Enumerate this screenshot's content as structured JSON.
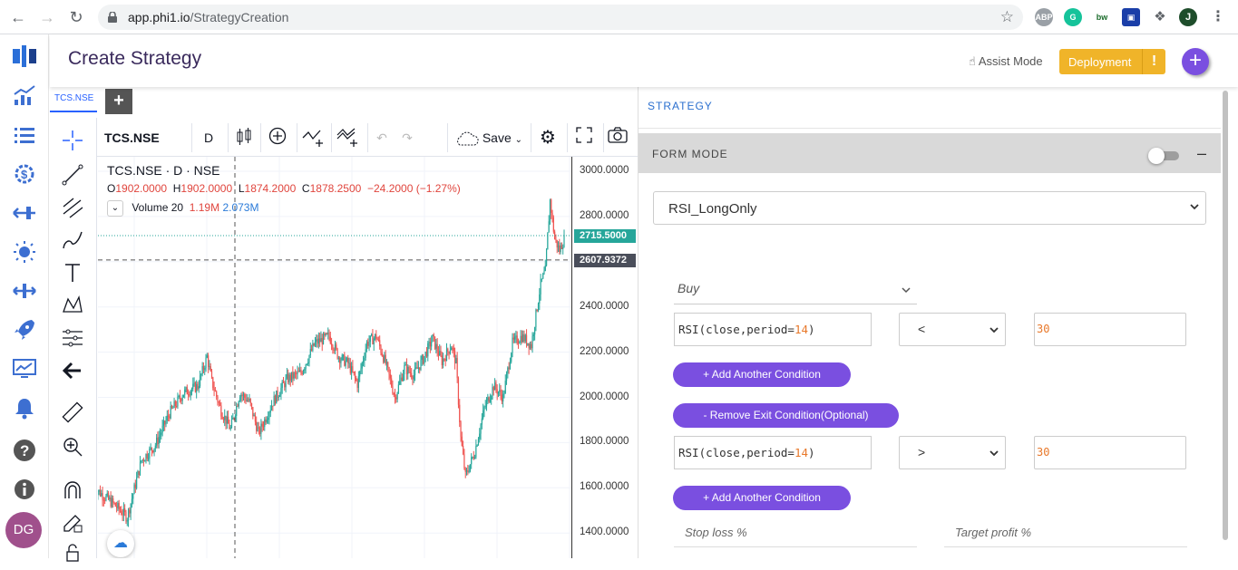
{
  "browser": {
    "url_host": "app.phi1.io",
    "url_path": "/StrategyCreation",
    "profile_initial": "J",
    "ext_abp": "ABP",
    "ext_bw": "bw"
  },
  "header": {
    "title": "Create Strategy",
    "assist_mode": "Assist Mode",
    "deployment": "Deployment",
    "deployment_alert": "!",
    "add": "+"
  },
  "sidebar": {
    "avatar_initials": "DG"
  },
  "chart_tabs": {
    "active": "TCS.NSE",
    "add": "+"
  },
  "toolbar": {
    "symbol": "TCS.NSE",
    "interval": "D",
    "save": "Save"
  },
  "legend": {
    "title": "TCS.NSE · D · NSE",
    "o_label": "O",
    "o": "1902.0000",
    "h_label": "H",
    "h": "1902.0000",
    "l_label": "L",
    "l": "1874.2000",
    "c_label": "C",
    "c": "1878.2500",
    "change": "−24.2000 (−1.27%)",
    "volume_label": "Volume 20",
    "volume_value": "1.19M",
    "volume_ma": "2.073M"
  },
  "chart_data": {
    "type": "candlestick",
    "symbol": "TCS.NSE",
    "interval": "D",
    "y_ticks": [
      "3000.0000",
      "2800.0000",
      "2600.0000",
      "2400.0000",
      "2200.0000",
      "2000.0000",
      "1800.0000",
      "1600.0000",
      "1400.0000"
    ],
    "ylim": [
      1300,
      3000
    ],
    "price_line": "2715.5000",
    "crosshair_price": "2607.9372",
    "close_path": [
      {
        "t": 0,
        "v": 1600
      },
      {
        "t": 4,
        "v": 1530
      },
      {
        "t": 7,
        "v": 1470
      },
      {
        "t": 10,
        "v": 1720
      },
      {
        "t": 13,
        "v": 1790
      },
      {
        "t": 16,
        "v": 1930
      },
      {
        "t": 19,
        "v": 2020
      },
      {
        "t": 22,
        "v": 2050
      },
      {
        "t": 24,
        "v": 2180
      },
      {
        "t": 25,
        "v": 2070
      },
      {
        "t": 27,
        "v": 1940
      },
      {
        "t": 29,
        "v": 1860
      },
      {
        "t": 31,
        "v": 2020
      },
      {
        "t": 33,
        "v": 1980
      },
      {
        "t": 35,
        "v": 1840
      },
      {
        "t": 38,
        "v": 1980
      },
      {
        "t": 41,
        "v": 2080
      },
      {
        "t": 44,
        "v": 2110
      },
      {
        "t": 47,
        "v": 2240
      },
      {
        "t": 50,
        "v": 2270
      },
      {
        "t": 52,
        "v": 2180
      },
      {
        "t": 54,
        "v": 2150
      },
      {
        "t": 56,
        "v": 2060
      },
      {
        "t": 58,
        "v": 2240
      },
      {
        "t": 60,
        "v": 2270
      },
      {
        "t": 62,
        "v": 2150
      },
      {
        "t": 64,
        "v": 2000
      },
      {
        "t": 66,
        "v": 2130
      },
      {
        "t": 68,
        "v": 2100
      },
      {
        "t": 70,
        "v": 2170
      },
      {
        "t": 72,
        "v": 2260
      },
      {
        "t": 74,
        "v": 2160
      },
      {
        "t": 76,
        "v": 2230
      },
      {
        "t": 77,
        "v": 2150
      },
      {
        "t": 78,
        "v": 1820
      },
      {
        "t": 79,
        "v": 1650
      },
      {
        "t": 81,
        "v": 1760
      },
      {
        "t": 83,
        "v": 1950
      },
      {
        "t": 85,
        "v": 2050
      },
      {
        "t": 87,
        "v": 2000
      },
      {
        "t": 89,
        "v": 2240
      },
      {
        "t": 91,
        "v": 2270
      },
      {
        "t": 93,
        "v": 2230
      },
      {
        "t": 95,
        "v": 2500
      },
      {
        "t": 96,
        "v": 2560
      },
      {
        "t": 97,
        "v": 2870
      },
      {
        "t": 98,
        "v": 2700
      },
      {
        "t": 99,
        "v": 2650
      },
      {
        "t": 100,
        "v": 2700
      }
    ]
  },
  "strategy": {
    "section_title": "STRATEGY",
    "form_mode": "FORM MODE",
    "collapse": "–",
    "selected_strategy": "RSI_LongOnly",
    "side_placeholder": "Buy",
    "entry": {
      "expr_prefix": "RSI(close,period=",
      "expr_num": "14",
      "expr_suffix": ")",
      "operator": "<",
      "value": "30"
    },
    "add_condition": "+ Add Another Condition",
    "remove_exit": "- Remove Exit Condition(Optional)",
    "exit": {
      "expr_prefix": "RSI(close,period=",
      "expr_num": "14",
      "expr_suffix": ")",
      "operator": ">",
      "value": "30"
    },
    "add_condition_2": "+ Add Another Condition",
    "stop_loss": "Stop loss %",
    "target_profit": "Target profit %"
  },
  "colors": {
    "accent_purple": "#7a4fe0",
    "deploy_orange": "#f0b429",
    "up_candle": "#26a69a",
    "down_candle": "#ef5350",
    "price_tag": "#26a69a",
    "crosshair_tag": "#4a4e5a"
  }
}
